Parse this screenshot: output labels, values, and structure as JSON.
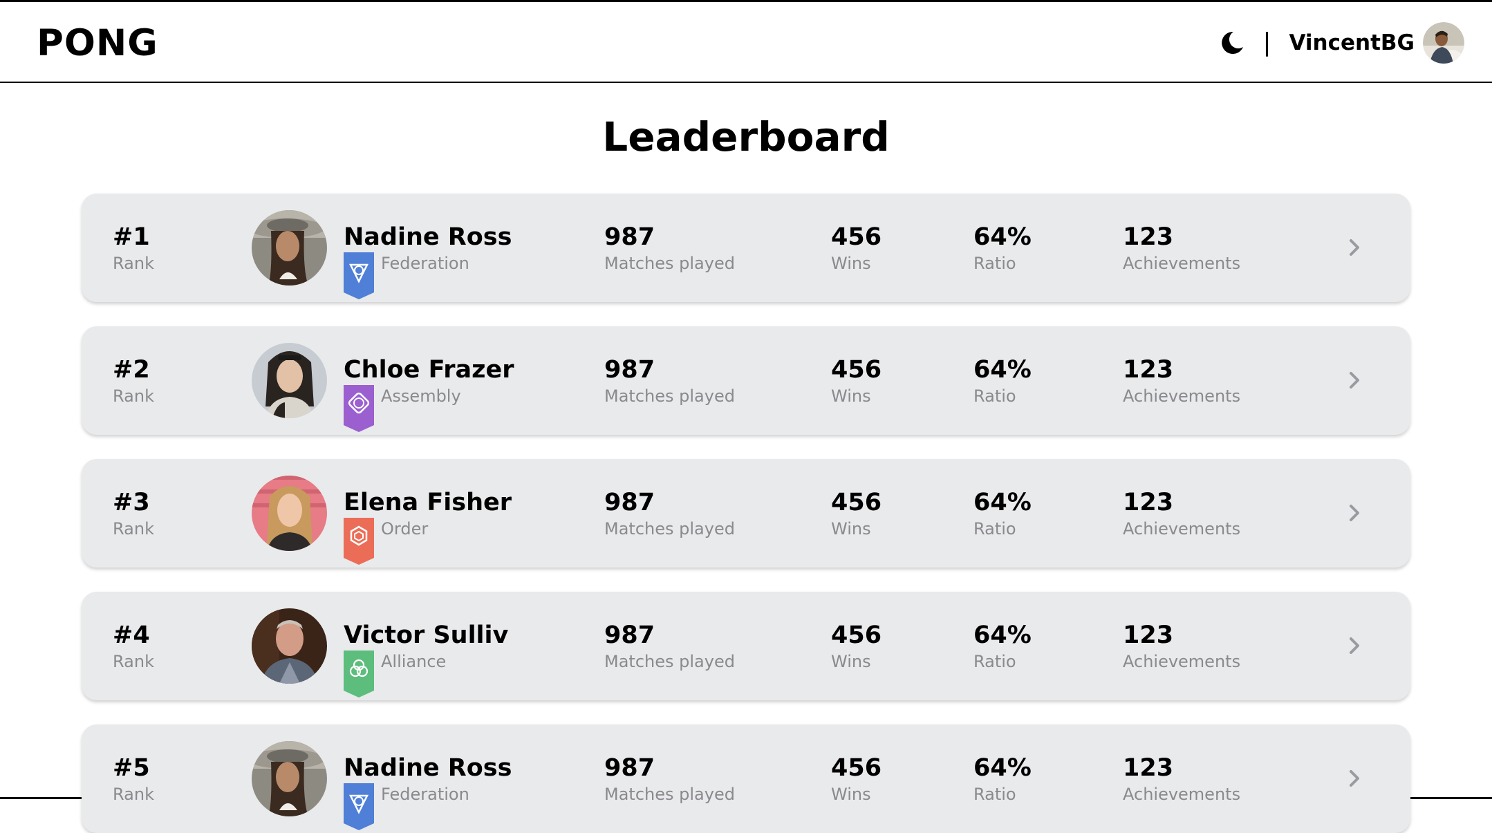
{
  "app": {
    "logo": "PONG",
    "separator": "|",
    "username": "VincentBG",
    "icons": {
      "theme_toggle": "moon-icon",
      "row_open": "chevron-right-icon"
    }
  },
  "page": {
    "title": "Leaderboard"
  },
  "colors": {
    "row_background": "#e9eaec",
    "muted_text": "#8a8a8e",
    "federation": "#4f7fd6",
    "assembly": "#9b5fd0",
    "order": "#ec6d57",
    "alliance": "#5dbd7c"
  },
  "leaderboard": {
    "rows": [
      {
        "rank": "#1",
        "rank_label": "Rank",
        "name": "Nadine Ross",
        "faction": "Federation",
        "faction_color": "#4f7fd6",
        "faction_icon": "federation-icon",
        "matches": "987",
        "matches_label": "Matches played",
        "wins": "456",
        "wins_label": "Wins",
        "ratio": "64%",
        "ratio_label": "Ratio",
        "achievements": "123",
        "achievements_label": "Achievements"
      },
      {
        "rank": "#2",
        "rank_label": "Rank",
        "name": "Chloe Frazer",
        "faction": "Assembly",
        "faction_color": "#9b5fd0",
        "faction_icon": "assembly-icon",
        "matches": "987",
        "matches_label": "Matches played",
        "wins": "456",
        "wins_label": "Wins",
        "ratio": "64%",
        "ratio_label": "Ratio",
        "achievements": "123",
        "achievements_label": "Achievements"
      },
      {
        "rank": "#3",
        "rank_label": "Rank",
        "name": "Elena Fisher",
        "faction": "Order",
        "faction_color": "#ec6d57",
        "faction_icon": "order-icon",
        "matches": "987",
        "matches_label": "Matches played",
        "wins": "456",
        "wins_label": "Wins",
        "ratio": "64%",
        "ratio_label": "Ratio",
        "achievements": "123",
        "achievements_label": "Achievements"
      },
      {
        "rank": "#4",
        "rank_label": "Rank",
        "name": "Victor Sulliv",
        "faction": "Alliance",
        "faction_color": "#5dbd7c",
        "faction_icon": "alliance-icon",
        "matches": "987",
        "matches_label": "Matches played",
        "wins": "456",
        "wins_label": "Wins",
        "ratio": "64%",
        "ratio_label": "Ratio",
        "achievements": "123",
        "achievements_label": "Achievements"
      },
      {
        "rank": "#5",
        "rank_label": "Rank",
        "name": "Nadine Ross",
        "faction": "Federation",
        "faction_color": "#4f7fd6",
        "faction_icon": "federation-icon",
        "matches": "987",
        "matches_label": "Matches played",
        "wins": "456",
        "wins_label": "Wins",
        "ratio": "64%",
        "ratio_label": "Ratio",
        "achievements": "123",
        "achievements_label": "Achievements"
      }
    ]
  }
}
